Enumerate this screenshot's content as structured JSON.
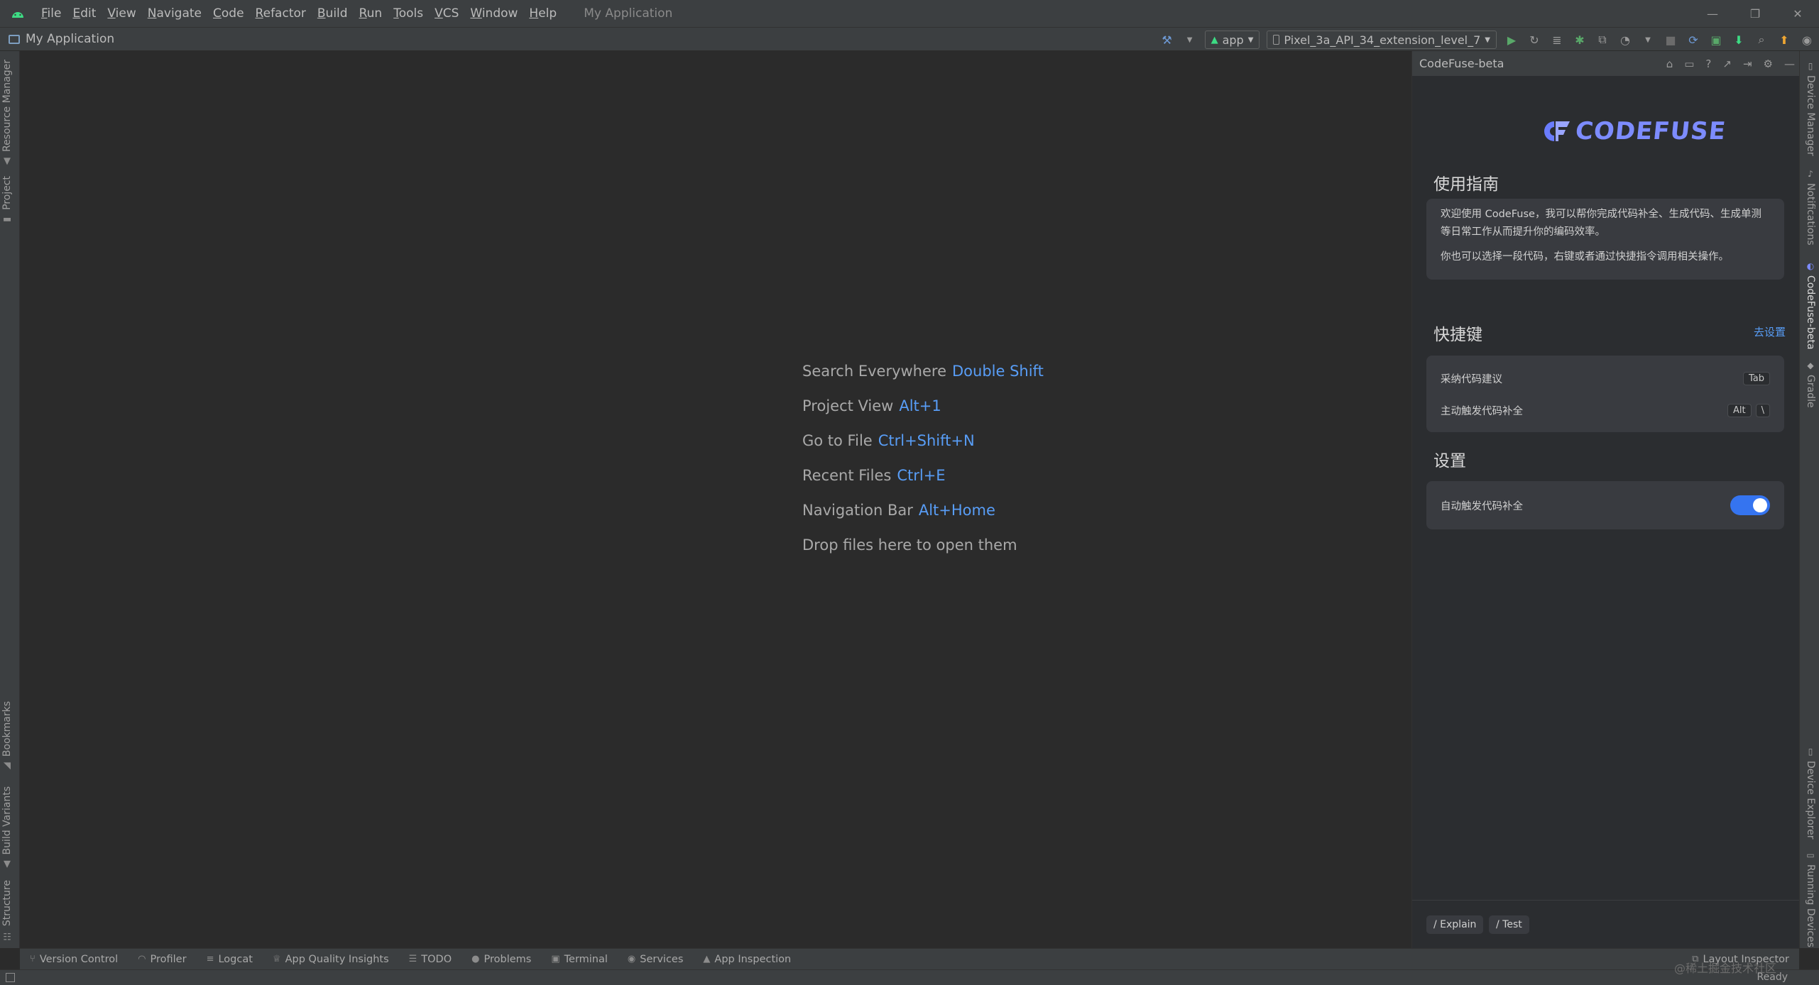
{
  "menubar": {
    "items": [
      "File",
      "Edit",
      "View",
      "Navigate",
      "Code",
      "Refactor",
      "Build",
      "Run",
      "Tools",
      "VCS",
      "Window",
      "Help"
    ],
    "app_title": "My Application"
  },
  "toolbar": {
    "project": "My Application",
    "run_config": "app",
    "device": "Pixel_3a_API_34_extension_level_7"
  },
  "left_tabs": [
    "Resource Manager",
    "Project",
    "Bookmarks",
    "Build Variants",
    "Structure"
  ],
  "right_tabs": [
    "Device Manager",
    "Notifications",
    "CodeFuse-beta",
    "Gradle",
    "Device Explorer",
    "Running Devices"
  ],
  "editor_hints": [
    {
      "label": "Search Everywhere",
      "key": "Double Shift"
    },
    {
      "label": "Project View",
      "key": "Alt+1"
    },
    {
      "label": "Go to File",
      "key": "Ctrl+Shift+N"
    },
    {
      "label": "Recent Files",
      "key": "Ctrl+E"
    },
    {
      "label": "Navigation Bar",
      "key": "Alt+Home"
    },
    {
      "label": "Drop files here to open them",
      "key": ""
    }
  ],
  "codefuse": {
    "header": "CodeFuse-beta",
    "logo_text": "CODEFUSE",
    "guide_title": "使用指南",
    "guide_p1": "欢迎使用 CodeFuse，我可以帮你完成代码补全、生成代码、生成单测等日常工作从而提升你的编码效率。",
    "guide_p2": "你也可以选择一段代码，右键或者通过快捷指令调用相关操作。",
    "shortcuts_title": "快捷键",
    "shortcuts_link": "去设置",
    "shortcuts": [
      {
        "label": "采纳代码建议",
        "keys": [
          "Tab"
        ]
      },
      {
        "label": "主动触发代码补全",
        "keys": [
          "Alt",
          "\\"
        ]
      }
    ],
    "settings_title": "设置",
    "settings_item": "自动触发代码补全",
    "settings_enabled": true,
    "chips": [
      "/ Explain",
      "/ Test"
    ]
  },
  "bottom_tabs": [
    "Version Control",
    "Profiler",
    "Logcat",
    "App Quality Insights",
    "TODO",
    "Problems",
    "Terminal",
    "Services",
    "App Inspection"
  ],
  "bottom_right": "Layout Inspector",
  "status": {
    "ready": "Ready",
    "watermark": "@稀土掘金技术社区"
  }
}
